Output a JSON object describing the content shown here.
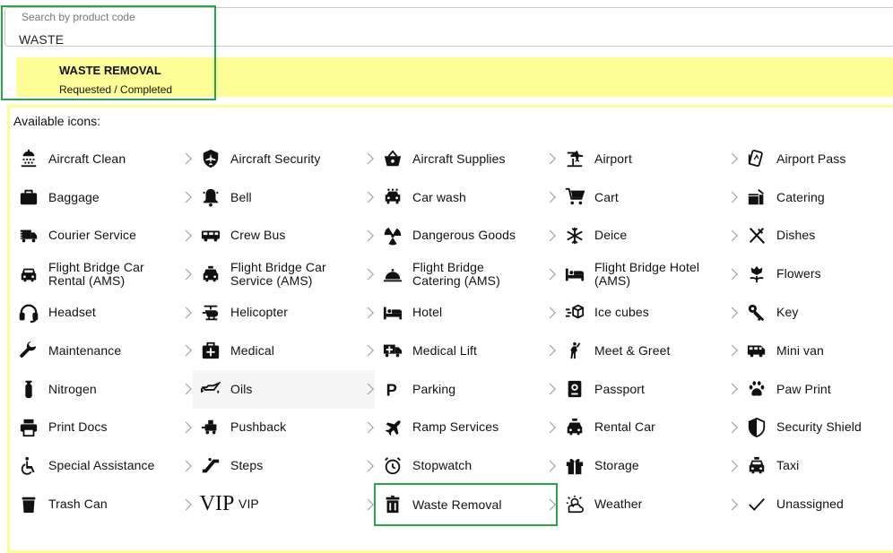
{
  "search": {
    "legend": "Search by product code",
    "value": "WASTE"
  },
  "suggestion": {
    "title": "WASTE REMOVAL",
    "subtitle": "Requested / Completed"
  },
  "panel": {
    "label": "Available icons:"
  },
  "icons": [
    {
      "label": "Aircraft Clean",
      "icon": "shower-icon"
    },
    {
      "label": "Aircraft Security",
      "icon": "shield-plane-icon"
    },
    {
      "label": "Aircraft Supplies",
      "icon": "basket-icon"
    },
    {
      "label": "Airport",
      "icon": "airport-icon"
    },
    {
      "label": "Airport Pass",
      "icon": "pass-card-icon"
    },
    {
      "label": "Baggage",
      "icon": "briefcase-icon"
    },
    {
      "label": "Bell",
      "icon": "bell-icon"
    },
    {
      "label": "Car wash",
      "icon": "car-wash-icon"
    },
    {
      "label": "Cart",
      "icon": "cart-icon"
    },
    {
      "label": "Catering",
      "icon": "catering-icon"
    },
    {
      "label": "Courier Service",
      "icon": "truck-icon"
    },
    {
      "label": "Crew Bus",
      "icon": "bus-icon"
    },
    {
      "label": "Dangerous Goods",
      "icon": "radiation-icon"
    },
    {
      "label": "Deice",
      "icon": "snowflake-icon"
    },
    {
      "label": "Dishes",
      "icon": "fork-knife-icon"
    },
    {
      "label": "Flight Bridge Car Rental (AMS)",
      "icon": "car-icon"
    },
    {
      "label": "Flight Bridge Car Service (AMS)",
      "icon": "taxi-icon"
    },
    {
      "label": "Flight Bridge Catering (AMS)",
      "icon": "cloche-icon"
    },
    {
      "label": "Flight Bridge Hotel (AMS)",
      "icon": "bed-icon"
    },
    {
      "label": "Flowers",
      "icon": "flower-icon"
    },
    {
      "label": "Headset",
      "icon": "headset-icon"
    },
    {
      "label": "Helicopter",
      "icon": "helicopter-icon"
    },
    {
      "label": "Hotel",
      "icon": "hotel-bed-icon"
    },
    {
      "label": "Ice cubes",
      "icon": "ice-cube-icon"
    },
    {
      "label": "Key",
      "icon": "key-icon"
    },
    {
      "label": "Maintenance",
      "icon": "wrench-icon"
    },
    {
      "label": "Medical",
      "icon": "medical-bag-icon"
    },
    {
      "label": "Medical Lift",
      "icon": "ambulance-icon"
    },
    {
      "label": "Meet & Greet",
      "icon": "person-wave-icon"
    },
    {
      "label": "Mini van",
      "icon": "van-icon"
    },
    {
      "label": "Nitrogen",
      "icon": "gas-cylinder-icon"
    },
    {
      "label": "Oils",
      "icon": "oil-can-icon"
    },
    {
      "label": "Parking",
      "icon": "parking-icon"
    },
    {
      "label": "Passport",
      "icon": "passport-icon"
    },
    {
      "label": "Paw Print",
      "icon": "paw-icon"
    },
    {
      "label": "Print Docs",
      "icon": "printer-icon"
    },
    {
      "label": "Pushback",
      "icon": "tug-icon"
    },
    {
      "label": "Ramp Services",
      "icon": "plane-icon"
    },
    {
      "label": "Rental Car",
      "icon": "rental-car-icon"
    },
    {
      "label": "Security Shield",
      "icon": "security-shield-icon"
    },
    {
      "label": "Special Assistance",
      "icon": "wheelchair-icon"
    },
    {
      "label": "Steps",
      "icon": "escalator-icon"
    },
    {
      "label": "Stopwatch",
      "icon": "alarm-clock-icon"
    },
    {
      "label": "Storage",
      "icon": "gift-box-icon"
    },
    {
      "label": "Taxi",
      "icon": "taxi-front-icon"
    },
    {
      "label": "Trash Can",
      "icon": "trash-icon"
    },
    {
      "label": "VIP",
      "icon": "vip-icon",
      "glyph": "VIP"
    },
    {
      "label": "Waste Removal",
      "icon": "waste-bin-icon"
    },
    {
      "label": "Weather",
      "icon": "weather-icon"
    },
    {
      "label": "Unassigned",
      "icon": "check-icon"
    }
  ],
  "hover_index": 31,
  "selected_index": 47,
  "colors": {
    "highlight": "#fdfd96",
    "selection_border": "#27a644"
  }
}
